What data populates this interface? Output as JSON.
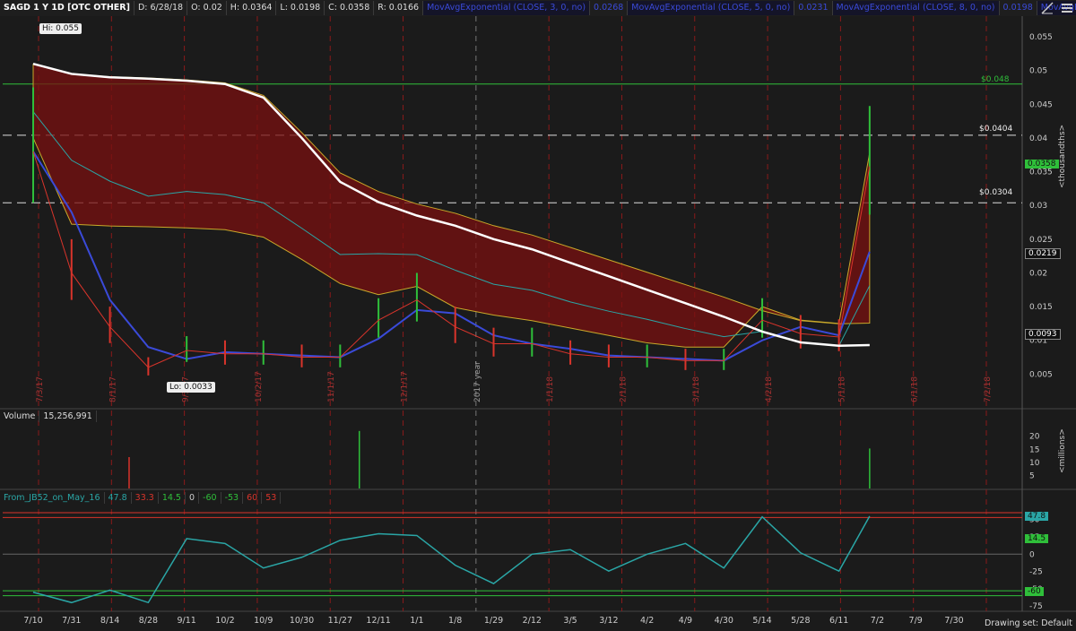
{
  "header": {
    "symbol": "SAGD 1 Y 1D [OTC OTHER]",
    "date": "D: 6/28/18",
    "open": "O: 0.02",
    "high": "H: 0.0364",
    "low": "L: 0.0198",
    "close": "C: 0.0358",
    "range": "R: 0.0166",
    "studies": [
      "MovAvgExponential (CLOSE, 3, 0, no)",
      "0.0268",
      "MovAvgExponential (CLOSE, 5, 0, no)",
      "0.0231",
      "MovAvgExponential (CLOSE, 8, 0, no)",
      "0.0198",
      "MovAvgExponential"
    ]
  },
  "price_labels": {
    "hi": "Hi: 0.055",
    "lo": "Lo: 0.0033",
    "line_048": "$0.048",
    "line_0404": "$0.0404",
    "line_0304": "$0.0304",
    "last": "0.0358",
    "ema": "0.0219",
    "sma": "0.0093",
    "axis_unit": "<thousandths>"
  },
  "volume": {
    "title": "Volume",
    "value": "15,256,991",
    "unit": "<millions>"
  },
  "oscillator": {
    "title": "From_JB52_on_May_16",
    "values": [
      "47.8",
      "33.3",
      "14.5",
      "0",
      "-60",
      "-53",
      "60",
      "53"
    ],
    "badge_47": "47.8",
    "badge_14": "14.5",
    "badge_neg60": "-60"
  },
  "footer": {
    "drawing_set": "Drawing set: Default"
  },
  "colors": {
    "bg": "#1b1b1b",
    "grid_red": "#8a1a1a",
    "cloud": "#7a1010",
    "cloud_yellow": "#c9a92a",
    "ma_blue": "#3a4ad8",
    "sma_white": "#ffffff",
    "cyan": "#2aa6a6",
    "green": "#2fbf3a",
    "red": "#d9342b"
  },
  "chart_data": {
    "type": "line",
    "title": "SAGD 1 Y 1D [OTC OTHER]",
    "xlabel": "",
    "ylabel": "<thousandths>",
    "ylim": [
      0,
      0.057
    ],
    "yticks": [
      0.005,
      0.01,
      0.015,
      0.02,
      0.025,
      0.03,
      0.035,
      0.04,
      0.045,
      0.05,
      0.055
    ],
    "ytick_labels": [
      "0.005",
      "0.01",
      "0.015",
      "0.02",
      "0.025",
      "0.03",
      "0.035",
      "0.04",
      "0.045",
      "0.05",
      "0.055"
    ],
    "x_ticks": [
      "7/10",
      "7/31",
      "8/14",
      "8/28",
      "9/11",
      "10/2",
      "10/9",
      "10/30",
      "11/27",
      "12/11",
      "1/1",
      "1/8",
      "1/29",
      "2/12",
      "3/5",
      "3/12",
      "4/2",
      "4/9",
      "4/30",
      "5/14",
      "5/28",
      "6/11",
      "7/2",
      "7/9",
      "7/30"
    ],
    "month_markers": [
      "7/3/17",
      "8/1/17",
      "9/1/17",
      "10/2/17",
      "11/1/17",
      "12/1/17",
      "2017 year",
      "1/1/18",
      "2/1/18",
      "3/1/18",
      "4/2/18",
      "5/1/18",
      "6/1/18",
      "7/2/18"
    ],
    "horizontal_lines": [
      0.048,
      0.0404,
      0.0304
    ],
    "series": [
      {
        "name": "Price",
        "x": [
          "7/10",
          "7/31",
          "8/14",
          "8/28",
          "9/11",
          "10/2",
          "10/9",
          "10/30",
          "11/27",
          "12/11",
          "1/1",
          "1/8",
          "1/29",
          "2/12",
          "3/5",
          "3/12",
          "4/2",
          "4/9",
          "4/30",
          "5/14",
          "5/28",
          "6/11",
          "6/28"
        ],
        "values": [
          0.038,
          0.02,
          0.012,
          0.006,
          0.0085,
          0.008,
          0.008,
          0.0075,
          0.0075,
          0.013,
          0.016,
          0.012,
          0.0095,
          0.0095,
          0.008,
          0.0075,
          0.0075,
          0.007,
          0.007,
          0.013,
          0.011,
          0.0105,
          0.0358
        ]
      },
      {
        "name": "SMA",
        "x": [
          "7/10",
          "7/31",
          "8/14",
          "8/28",
          "9/11",
          "10/2",
          "10/9",
          "10/30",
          "11/27",
          "12/11",
          "1/1",
          "1/8",
          "1/29",
          "2/12",
          "3/5",
          "3/12",
          "4/2",
          "4/9",
          "4/30",
          "5/14",
          "5/28",
          "6/11",
          "6/28"
        ],
        "values": [
          0.051,
          0.0495,
          0.049,
          0.0488,
          0.0485,
          0.048,
          0.046,
          0.04,
          0.0335,
          0.0305,
          0.0285,
          0.027,
          0.025,
          0.0235,
          0.0215,
          0.0195,
          0.0175,
          0.0155,
          0.0135,
          0.0113,
          0.0097,
          0.0092,
          0.0093
        ]
      }
    ],
    "volume": {
      "unit": "<millions>",
      "yticks": [
        5,
        10,
        15,
        20
      ],
      "spikes": [
        {
          "x": "12/4",
          "value": 22
        },
        {
          "x": "6/28",
          "value": 15.3
        },
        {
          "x": "8/21",
          "value": 12
        }
      ]
    },
    "oscillator": {
      "yticks": [
        -75,
        -50,
        -25,
        0,
        25,
        50
      ],
      "levels": [
        60,
        53,
        -53,
        -60
      ],
      "last": 47.8,
      "signal": 33.3
    }
  }
}
